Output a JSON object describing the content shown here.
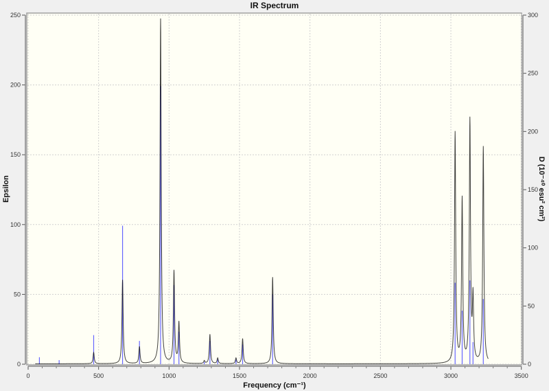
{
  "chart_data": {
    "type": "line",
    "title": "IR Spectrum",
    "xlabel": "Frequency (cm⁻¹)",
    "ylabel": "Epsilon",
    "y2label": "D (10⁻⁴⁰ esu² cm²)",
    "xlim": [
      0,
      3500
    ],
    "ylim": [
      0,
      250
    ],
    "y2lim": [
      0,
      300
    ],
    "xticks": [
      0,
      500,
      1000,
      1500,
      2000,
      2500,
      3000,
      3500
    ],
    "yticks": [
      0,
      50,
      100,
      150,
      200,
      250
    ],
    "y2ticks": [
      0,
      50,
      100,
      150,
      200,
      250,
      300
    ],
    "grid": true,
    "colors": {
      "spectrum": "#000000",
      "sticks": "#6666ff",
      "plot_bg": "#fffff5"
    },
    "spectrum_peaks": [
      {
        "x": 465,
        "y": 8
      },
      {
        "x": 670,
        "y": 60
      },
      {
        "x": 790,
        "y": 12
      },
      {
        "x": 940,
        "y": 247
      },
      {
        "x": 1035,
        "y": 66
      },
      {
        "x": 1070,
        "y": 29
      },
      {
        "x": 1250,
        "y": 2
      },
      {
        "x": 1290,
        "y": 21
      },
      {
        "x": 1345,
        "y": 4
      },
      {
        "x": 1475,
        "y": 4
      },
      {
        "x": 1522,
        "y": 18
      },
      {
        "x": 1735,
        "y": 62
      },
      {
        "x": 3030,
        "y": 165
      },
      {
        "x": 3080,
        "y": 117
      },
      {
        "x": 3135,
        "y": 173
      },
      {
        "x": 3157,
        "y": 45
      },
      {
        "x": 3230,
        "y": 155
      }
    ],
    "sticks_D": [
      {
        "x": 80,
        "y": 6
      },
      {
        "x": 220,
        "y": 3.5
      },
      {
        "x": 465,
        "y": 25
      },
      {
        "x": 670,
        "y": 119
      },
      {
        "x": 790,
        "y": 20
      },
      {
        "x": 940,
        "y": 239
      },
      {
        "x": 1035,
        "y": 68
      },
      {
        "x": 1070,
        "y": 28
      },
      {
        "x": 1250,
        "y": 2
      },
      {
        "x": 1290,
        "y": 20
      },
      {
        "x": 1345,
        "y": 4
      },
      {
        "x": 1475,
        "y": 4
      },
      {
        "x": 1522,
        "y": 17
      },
      {
        "x": 1735,
        "y": 60
      },
      {
        "x": 3030,
        "y": 70
      },
      {
        "x": 3080,
        "y": 46
      },
      {
        "x": 3135,
        "y": 72
      },
      {
        "x": 3157,
        "y": 19
      },
      {
        "x": 3230,
        "y": 56
      }
    ]
  }
}
